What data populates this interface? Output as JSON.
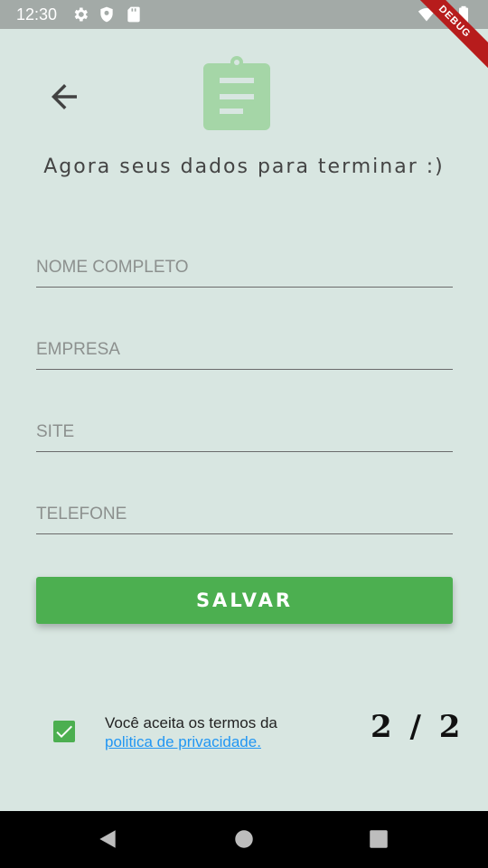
{
  "status_bar": {
    "time": "12:30",
    "debug_label": "DEBUG",
    "icons": [
      "gear-icon",
      "shield-icon",
      "sd-card-icon",
      "wifi-icon",
      "battery-icon"
    ]
  },
  "header": {
    "back_icon": "arrow-left-icon",
    "logo_icon": "clipboard-icon",
    "subtitle": "Agora seus dados para terminar :)"
  },
  "form": {
    "fields": [
      {
        "placeholder": "NOME COMPLETO",
        "value": ""
      },
      {
        "placeholder": "EMPRESA",
        "value": ""
      },
      {
        "placeholder": "SITE",
        "value": ""
      },
      {
        "placeholder": "TELEFONE",
        "value": ""
      }
    ],
    "save_label": "SALVAR"
  },
  "terms": {
    "checked": true,
    "text": "Você aceita os termos da",
    "link": "politica de privacidade."
  },
  "page_indicator": "2 / 2",
  "colors": {
    "background": "#d8e6e1",
    "accent": "#4caf50",
    "link": "#2196f3",
    "clipboard": "#a5d6a7"
  },
  "nav_bar": {
    "buttons": [
      "back-triangle-icon",
      "home-circle-icon",
      "recents-square-icon"
    ]
  }
}
